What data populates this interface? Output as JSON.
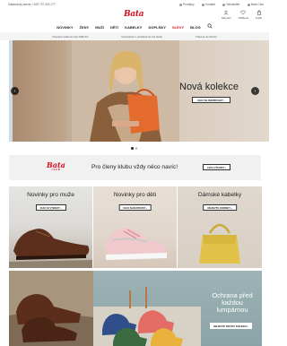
{
  "util": {
    "phone": "Zákaznický servis: +420 737 002 177",
    "links": [
      "Prodejny",
      "Kontakt",
      "Newsletter",
      "Bata Club"
    ]
  },
  "header": {
    "logo": "Bata",
    "icons": [
      {
        "name": "account",
        "label": "Můj účet"
      },
      {
        "name": "wishlist",
        "label": "Oblíbené"
      },
      {
        "name": "cart",
        "label": "Košík"
      }
    ]
  },
  "nav": {
    "items": [
      "NOVINKY",
      "ŽENY",
      "MUŽI",
      "DĚTI",
      "KABELKY",
      "DOPLŇKY",
      "SLEVY",
      "BLOG"
    ]
  },
  "promo": {
    "items": [
      "Doprava zdarma nad 1499 Kč",
      "Vyzvednutí v prodejně do 24 hodin",
      "Vrácení do 30 dní"
    ]
  },
  "hero": {
    "title": "Nová kolekce",
    "button": "CHCI SE INSPIROVAT ›",
    "prev": "‹",
    "next": "›"
  },
  "club": {
    "logo": "Bata",
    "logo_sub": "CLUB",
    "text": "Pro členy klubu vždy něco navíc!",
    "button": "CHCI VÝHODY ›"
  },
  "tiles": [
    {
      "title": "Novinky pro muže",
      "button": "CHCI SI VYBRAT ›"
    },
    {
      "title": "Novinky pro děti",
      "button": "CHCI NAKUPOVAT ›"
    },
    {
      "title": "Dámské kabelky",
      "button": "OBJEVTE KORNKY ›"
    }
  ],
  "kids": {
    "title": "Ochrana před každou lumpárnou",
    "button": "OBJEVTE NOVOU KOLEKCI ›"
  },
  "colors": {
    "brand": "#d50e1d",
    "sale": "#d50e1d"
  }
}
